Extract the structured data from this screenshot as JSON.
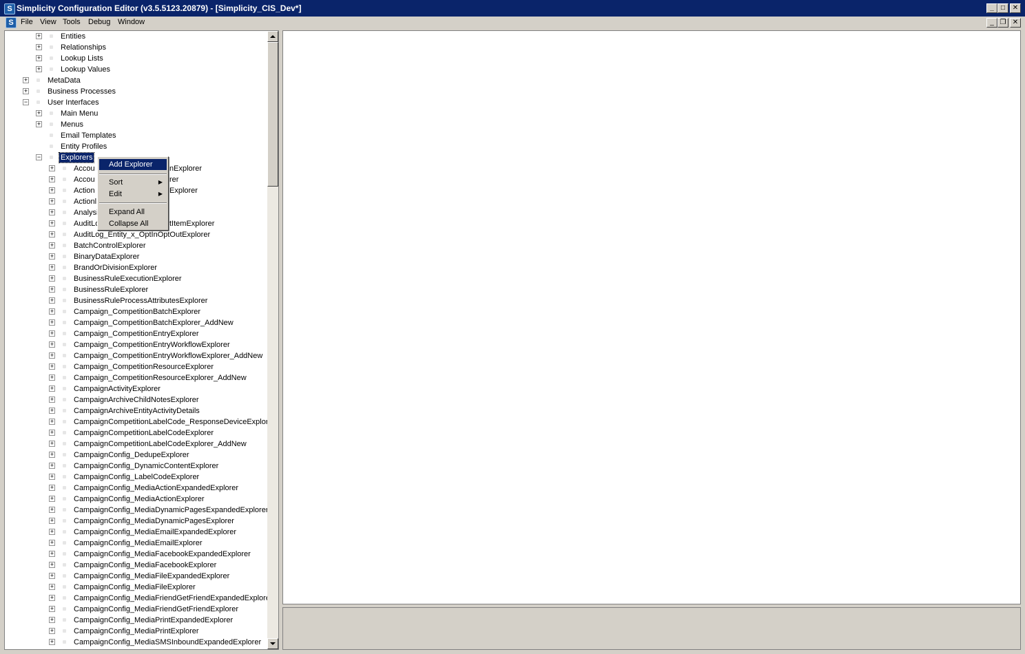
{
  "window": {
    "title": "Simplicity Configuration Editor (v3.5.5123.20879) - [Simplicity_CIS_Dev*]",
    "app_icon_letter": "S",
    "caption_buttons": [
      "minimize-icon",
      "maximize-icon",
      "close-icon"
    ]
  },
  "menubar": {
    "icon_letter": "S",
    "items": [
      "File",
      "View",
      "Tools",
      "Debug",
      "Window"
    ]
  },
  "tree": {
    "items": [
      {
        "label": "Entities",
        "level": 2,
        "expander": "+"
      },
      {
        "label": "Relationships",
        "level": 2,
        "expander": "+"
      },
      {
        "label": "Lookup Lists",
        "level": 2,
        "expander": "+"
      },
      {
        "label": "Lookup Values",
        "level": 2,
        "expander": "+"
      },
      {
        "label": "MetaData",
        "level": 1,
        "expander": "+"
      },
      {
        "label": "Business Processes",
        "level": 1,
        "expander": "+"
      },
      {
        "label": "User Interfaces",
        "level": 1,
        "expander": "-"
      },
      {
        "label": "Main Menu",
        "level": 2,
        "expander": "+"
      },
      {
        "label": "Menus",
        "level": 2,
        "expander": "+"
      },
      {
        "label": "Email Templates",
        "level": 2,
        "expander": ""
      },
      {
        "label": "Entity Profiles",
        "level": 2,
        "expander": ""
      },
      {
        "label": "Explorers",
        "level": 2,
        "expander": "-",
        "selected": true
      },
      {
        "label": "AccountActionExplorer",
        "level": 3,
        "expander": "+",
        "partial": "Accou",
        "tail": "nExplorer"
      },
      {
        "label": "AccountActivityExplorer",
        "level": 3,
        "expander": "+",
        "partial": "Accou",
        "tail": "rer"
      },
      {
        "label": "Action_Explorer",
        "level": 3,
        "expander": "+",
        "partial": "Action",
        "tail": "Explorer"
      },
      {
        "label": "ActionExplorer",
        "level": 3,
        "expander": "+",
        "partial": "Actionl",
        "tail": ""
      },
      {
        "label": "AnalysisExplorer",
        "level": 3,
        "expander": "+",
        "partial": "Analysi",
        "tail": ""
      },
      {
        "label": "AuditLogListItemExplorer",
        "level": 3,
        "expander": "+",
        "partial": "AuditLo",
        "tail": "tItemExplorer"
      },
      {
        "label": "AuditLog_Entity_x_OptInOptOutExplorer",
        "level": 3,
        "expander": "+"
      },
      {
        "label": "BatchControlExplorer",
        "level": 3,
        "expander": "+"
      },
      {
        "label": "BinaryDataExplorer",
        "level": 3,
        "expander": "+"
      },
      {
        "label": "BrandOrDivisionExplorer",
        "level": 3,
        "expander": "+"
      },
      {
        "label": "BusinessRuleExecutionExplorer",
        "level": 3,
        "expander": "+"
      },
      {
        "label": "BusinessRuleExplorer",
        "level": 3,
        "expander": "+"
      },
      {
        "label": "BusinessRuleProcessAttributesExplorer",
        "level": 3,
        "expander": "+"
      },
      {
        "label": "Campaign_CompetitionBatchExplorer",
        "level": 3,
        "expander": "+"
      },
      {
        "label": "Campaign_CompetitionBatchExplorer_AddNew",
        "level": 3,
        "expander": "+"
      },
      {
        "label": "Campaign_CompetitionEntryExplorer",
        "level": 3,
        "expander": "+"
      },
      {
        "label": "Campaign_CompetitionEntryWorkflowExplorer",
        "level": 3,
        "expander": "+"
      },
      {
        "label": "Campaign_CompetitionEntryWorkflowExplorer_AddNew",
        "level": 3,
        "expander": "+"
      },
      {
        "label": "Campaign_CompetitionResourceExplorer",
        "level": 3,
        "expander": "+"
      },
      {
        "label": "Campaign_CompetitionResourceExplorer_AddNew",
        "level": 3,
        "expander": "+"
      },
      {
        "label": "CampaignActivityExplorer",
        "level": 3,
        "expander": "+"
      },
      {
        "label": "CampaignArchiveChildNotesExplorer",
        "level": 3,
        "expander": "+"
      },
      {
        "label": "CampaignArchiveEntityActivityDetails",
        "level": 3,
        "expander": "+"
      },
      {
        "label": "CampaignCompetitionLabelCode_ResponseDeviceExplorer",
        "level": 3,
        "expander": "+"
      },
      {
        "label": "CampaignCompetitionLabelCodeExplorer",
        "level": 3,
        "expander": "+"
      },
      {
        "label": "CampaignCompetitionLabelCodeExplorer_AddNew",
        "level": 3,
        "expander": "+"
      },
      {
        "label": "CampaignConfig_DedupeExplorer",
        "level": 3,
        "expander": "+"
      },
      {
        "label": "CampaignConfig_DynamicContentExplorer",
        "level": 3,
        "expander": "+"
      },
      {
        "label": "CampaignConfig_LabelCodeExplorer",
        "level": 3,
        "expander": "+"
      },
      {
        "label": "CampaignConfig_MediaActionExpandedExplorer",
        "level": 3,
        "expander": "+"
      },
      {
        "label": "CampaignConfig_MediaActionExplorer",
        "level": 3,
        "expander": "+"
      },
      {
        "label": "CampaignConfig_MediaDynamicPagesExpandedExplorer",
        "level": 3,
        "expander": "+"
      },
      {
        "label": "CampaignConfig_MediaDynamicPagesExplorer",
        "level": 3,
        "expander": "+"
      },
      {
        "label": "CampaignConfig_MediaEmailExpandedExplorer",
        "level": 3,
        "expander": "+"
      },
      {
        "label": "CampaignConfig_MediaEmailExplorer",
        "level": 3,
        "expander": "+"
      },
      {
        "label": "CampaignConfig_MediaFacebookExpandedExplorer",
        "level": 3,
        "expander": "+"
      },
      {
        "label": "CampaignConfig_MediaFacebookExplorer",
        "level": 3,
        "expander": "+"
      },
      {
        "label": "CampaignConfig_MediaFileExpandedExplorer",
        "level": 3,
        "expander": "+"
      },
      {
        "label": "CampaignConfig_MediaFileExplorer",
        "level": 3,
        "expander": "+"
      },
      {
        "label": "CampaignConfig_MediaFriendGetFriendExpandedExplorer",
        "level": 3,
        "expander": "+"
      },
      {
        "label": "CampaignConfig_MediaFriendGetFriendExplorer",
        "level": 3,
        "expander": "+"
      },
      {
        "label": "CampaignConfig_MediaPrintExpandedExplorer",
        "level": 3,
        "expander": "+"
      },
      {
        "label": "CampaignConfig_MediaPrintExplorer",
        "level": 3,
        "expander": "+"
      },
      {
        "label": "CampaignConfig_MediaSMSInboundExpandedExplorer",
        "level": 3,
        "expander": "+"
      }
    ]
  },
  "context_menu": {
    "items": [
      {
        "label": "Add Explorer",
        "highlight": true,
        "submenu": false
      },
      {
        "separator": true
      },
      {
        "label": "Sort",
        "submenu": true
      },
      {
        "label": "Edit",
        "submenu": true
      },
      {
        "separator": true
      },
      {
        "label": "Expand All",
        "submenu": false
      },
      {
        "label": "Collapse All",
        "submenu": false
      }
    ]
  },
  "colors": {
    "titlebar": "#0a246a",
    "selection": "#0a246a",
    "chrome": "#d4d0c8"
  }
}
